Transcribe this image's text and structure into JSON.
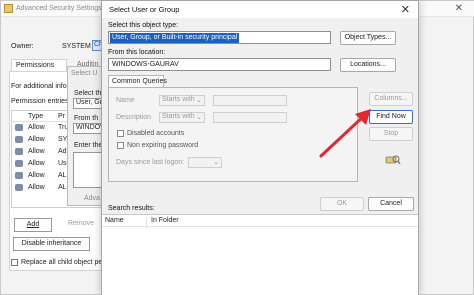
{
  "back_window": {
    "title": "Advanced Security Settings",
    "owner_label": "Owner:",
    "owner_value": "SYSTEM",
    "owner_change_link": "Ch",
    "tabs": [
      "Permissions",
      "Auditin"
    ],
    "additional_info": "For additional info",
    "permission_entries_label": "Permission entries:",
    "table_headers": [
      "Type",
      "Pr"
    ],
    "entries": [
      {
        "type": "Allow",
        "principal": "Tru"
      },
      {
        "type": "Allow",
        "principal": "SYS"
      },
      {
        "type": "Allow",
        "principal": "Adm"
      },
      {
        "type": "Allow",
        "principal": "Use"
      },
      {
        "type": "Allow",
        "principal": "ALL"
      },
      {
        "type": "Allow",
        "principal": "ALL"
      }
    ],
    "add_button": "Add",
    "remove_button": "Remove",
    "disable_inheritance_button": "Disable inheritance",
    "replace_label": "Replace all child object pe"
  },
  "middle_dialog": {
    "title": "Select U",
    "select_label": "Select th",
    "field1": "User, Grou",
    "from_label": "From th",
    "field2": "WINDOW",
    "enter_label": "Enter the c",
    "advanced_button": "Adva"
  },
  "front_dialog": {
    "title": "Select User or Group",
    "close_icon": "close-icon",
    "object_type_label": "Select this object type:",
    "object_type_value": "User, Group, or Built-in security principal",
    "object_types_button": "Object Types...",
    "location_label": "From this location:",
    "location_value": "WINDOWS-GAURAV",
    "locations_button": "Locations...",
    "common_queries_tab": "Common Queries",
    "name_label": "Name",
    "name_mode": "Starts with",
    "description_label": "Description",
    "description_mode": "Starts with",
    "disabled_accounts": "Disabled accounts",
    "non_expiring": "Non expiring password",
    "days_since_logon": "Days since last logon:",
    "columns_button": "Columns...",
    "find_now_button": "Find Now",
    "stop_button": "Stop",
    "ok_button": "OK",
    "cancel_button": "Cancel",
    "search_results_label": "Search results:",
    "results_headers": [
      "Name",
      "In Folder"
    ]
  },
  "annotation": {
    "arrow_color": "#e0282d"
  }
}
